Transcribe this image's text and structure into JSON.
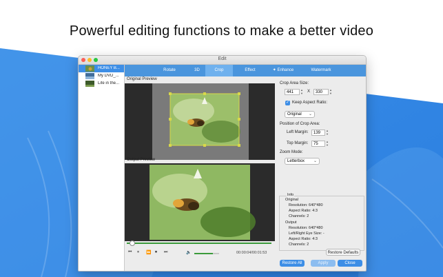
{
  "headline": "Powerful editing functions to make a better video",
  "window": {
    "title": "Edit"
  },
  "files": [
    {
      "name": "HONEY B...",
      "selected": true
    },
    {
      "name": "My DVD_...",
      "selected": false
    },
    {
      "name": "Life in the...",
      "selected": false
    }
  ],
  "tabs": [
    {
      "label": "Rotate",
      "active": false
    },
    {
      "label": "3D",
      "active": false
    },
    {
      "label": "Crop",
      "active": true
    },
    {
      "label": "Effect",
      "active": false
    },
    {
      "label": "Enhance",
      "active": false
    },
    {
      "label": "Watermark",
      "active": false
    }
  ],
  "previews": {
    "original_label": "Original Preview",
    "output_label": "Output Preview"
  },
  "player": {
    "time": "00:00:04/00:01:53",
    "progress": 0.02,
    "volume": 0.75
  },
  "crop": {
    "area_size_label": "Crop Area Size:",
    "width": "441",
    "times": "X",
    "height": "330",
    "keep_aspect_label": "Keep Aspect Ratio:",
    "aspect_value": "Original",
    "position_label": "Position of Crop Area:",
    "left_margin_label": "Left Margin:",
    "left_margin": "139",
    "top_margin_label": "Top Margin:",
    "top_margin": "75",
    "zoom_mode_label": "Zoom Mode:",
    "zoom_mode": "Letterbox"
  },
  "info": {
    "title": "Info",
    "original_heading": "Original",
    "original_resolution": "Resolution: 640*480",
    "original_aspect": "Aspect Ratio: 4:3",
    "original_channels": "Channels: 2",
    "output_heading": "Output",
    "output_resolution": "Resolution: 640*480",
    "output_eye": "Left/Right Eye Size: -",
    "output_aspect": "Aspect Ratio: 4:3",
    "output_channels": "Channels: 2"
  },
  "buttons": {
    "restore_defaults": "Restore Defaults",
    "restore_all": "Restore All",
    "apply": "Apply",
    "close": "Close"
  },
  "colors": {
    "accent": "#3d8ee6",
    "tab_bar": "#4a95dd",
    "hero_blue": "#2f86e6"
  }
}
